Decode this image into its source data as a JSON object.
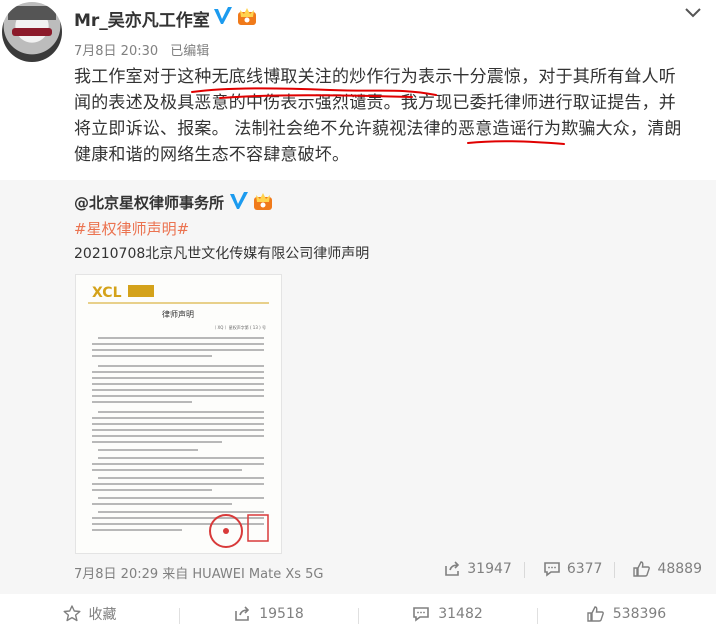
{
  "author": {
    "name": "Mr_吴亦凡工作室",
    "date": "7月8日 20:30",
    "edited_label": "已编辑"
  },
  "post": {
    "lines": [
      "我工作室对于这种无底线博取关注的炒作行为表示十分震惊，对于其所有耸人听",
      "闻的表述及极具恶意的中伤表示强烈谴责。我方现已委托律师进行取证提告，并",
      "将立即诉讼、报案。  法制社会绝不允许藐视法律的恶意造谣行为欺骗大众，清朗",
      "健康和谐的网络生态不容肆意破坏。"
    ]
  },
  "retweet": {
    "author": "@北京星权律师事务所",
    "hashtag": "#星权律师声明#",
    "text": "20210708北京凡世文化传媒有限公司律师声明",
    "document_title": "律师声明",
    "document_ref": "（ XQ ）星权声字第 ( 13 ) 号",
    "meta": "7月8日 20:29 来自 HUAWEI Mate Xs 5G",
    "reposts": "31947",
    "comments": "6377",
    "likes": "48889"
  },
  "actions": {
    "favorite_label": "收藏",
    "reposts": "19518",
    "comments": "31482",
    "likes": "538396"
  },
  "colors": {
    "hashtag": "#eb7350",
    "verified": "#1c9bef",
    "underline_red": "#e00000",
    "retweet_bg": "#f6f6f6"
  },
  "icons": {
    "verified": "verified-badge-icon",
    "vip": "vip-crown-icon",
    "menu": "chevron-down-icon",
    "favorite": "star-icon",
    "repost": "share-icon",
    "comment": "comment-icon",
    "like": "thumbs-up-icon"
  }
}
